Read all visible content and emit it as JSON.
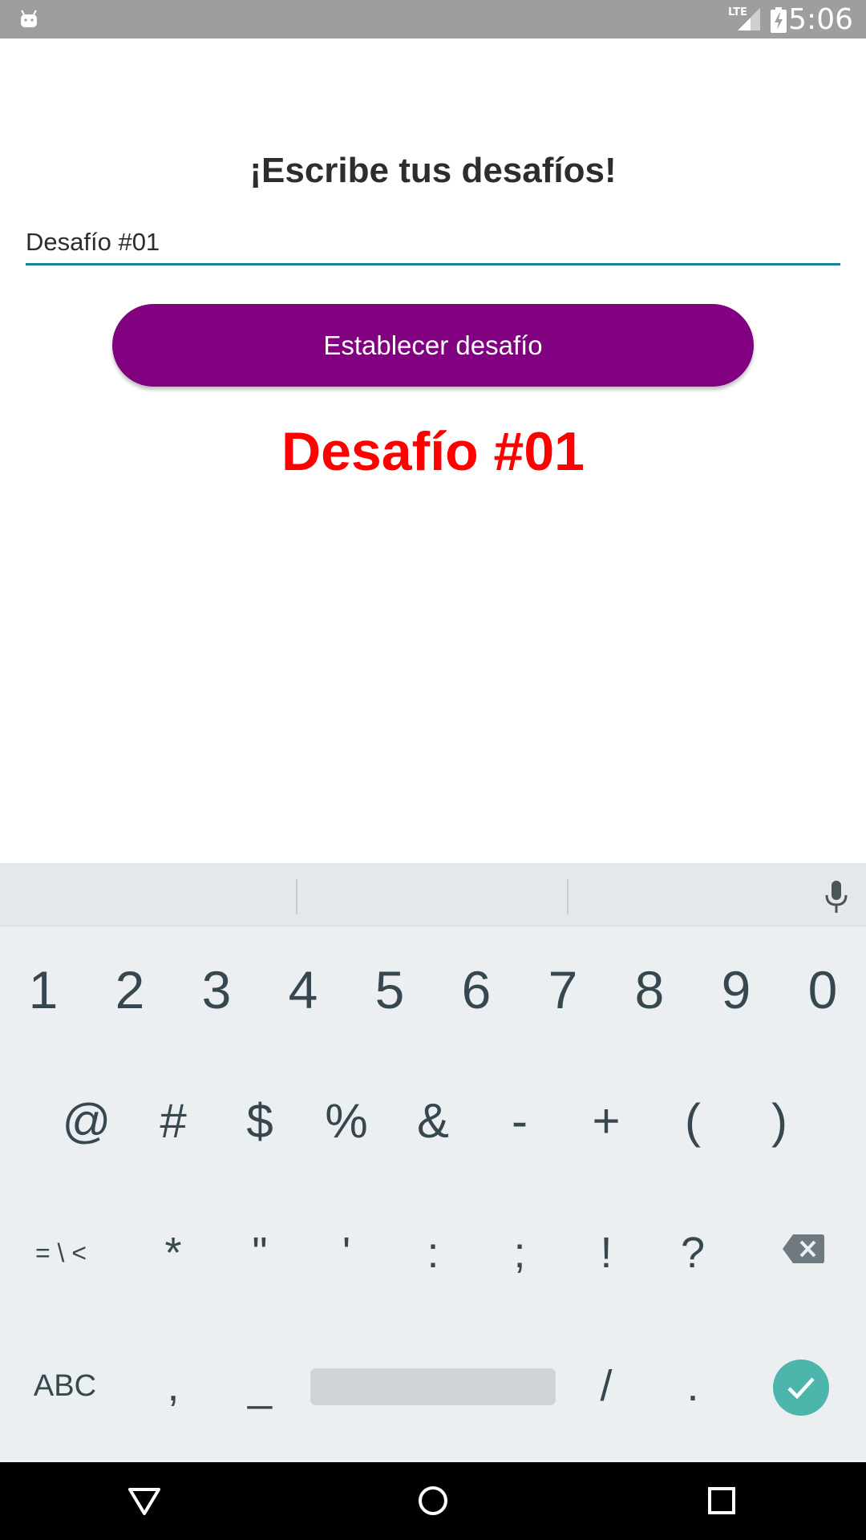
{
  "status_bar": {
    "time": "5:06",
    "network": "LTE",
    "icons": [
      "android-icon",
      "signal-icon",
      "battery-charging-icon"
    ]
  },
  "main": {
    "title": "¡Escribe tus desafíos!",
    "input_value": "Desafío #01",
    "button_label": "Establecer desafío",
    "challenge_display": "Desafío #01"
  },
  "keyboard": {
    "row1": [
      "1",
      "2",
      "3",
      "4",
      "5",
      "6",
      "7",
      "8",
      "9",
      "0"
    ],
    "row2": [
      "@",
      "#",
      "$",
      "%",
      "&",
      "-",
      "+",
      "(",
      ")"
    ],
    "row3": [
      "= \\ <",
      "*",
      "\"",
      "'",
      ":",
      ";",
      "!",
      "?"
    ],
    "row4": [
      "ABC",
      ",",
      "_",
      "/",
      "."
    ],
    "icons": [
      "mic-icon",
      "backspace-icon",
      "enter-check-icon"
    ]
  },
  "colors": {
    "button": "#800080",
    "challenge_text": "#FF0000",
    "input_underline": "#1B7FA0",
    "enter_key": "#4DB6AC"
  },
  "nav_bar": {
    "icons": [
      "back-icon",
      "home-icon",
      "recents-icon"
    ]
  }
}
